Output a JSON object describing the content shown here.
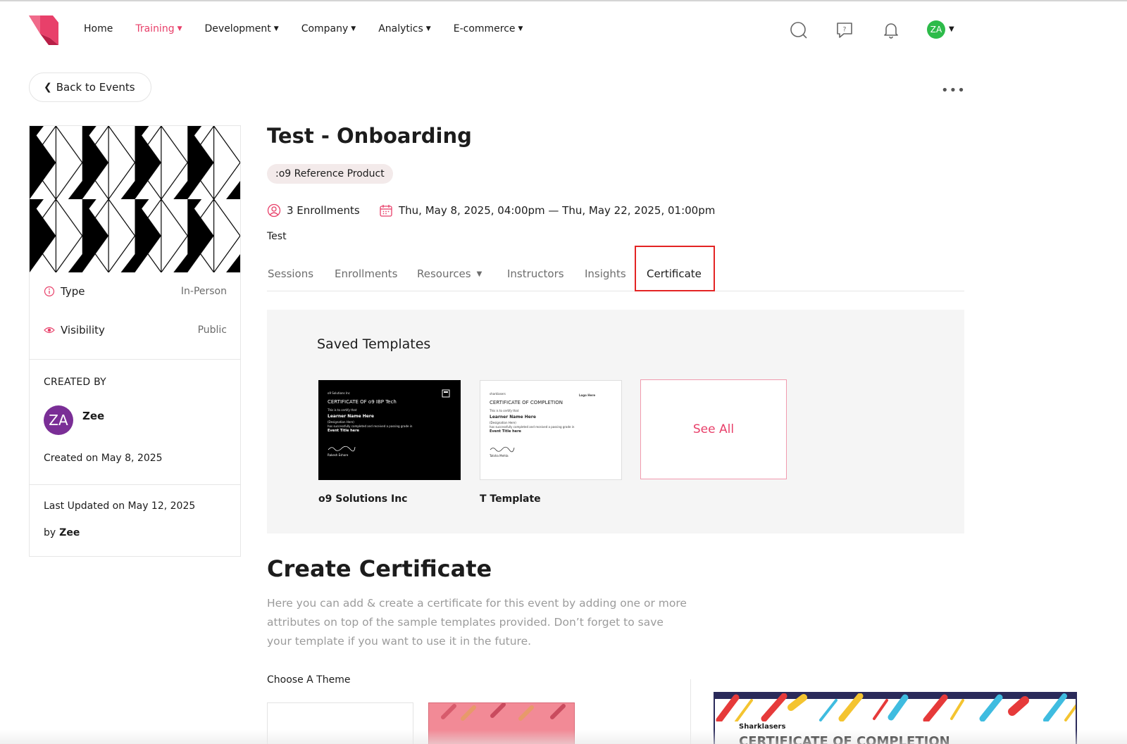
{
  "header": {
    "nav": [
      {
        "label": "Home",
        "active": false,
        "dropdown": false
      },
      {
        "label": "Training",
        "active": true,
        "dropdown": true
      },
      {
        "label": "Development",
        "active": false,
        "dropdown": true
      },
      {
        "label": "Company",
        "active": false,
        "dropdown": true
      },
      {
        "label": "Analytics",
        "active": false,
        "dropdown": true
      },
      {
        "label": "E-commerce",
        "active": false,
        "dropdown": true
      }
    ],
    "icons": [
      "search-icon",
      "help-chat-icon",
      "bell-icon"
    ],
    "user_initials": "ZA",
    "accent_color": "#e8406a"
  },
  "back_button": {
    "label": "Back to Events"
  },
  "event": {
    "title": "Test - Onboarding",
    "tag": ":o9 Reference Product",
    "enrollments": "3 Enrollments",
    "dates": "Thu, May 8, 2025, 04:00pm — Thu, May 22, 2025, 01:00pm",
    "description": "Test"
  },
  "sidebar": {
    "type_label": "Type",
    "type_value": "In-Person",
    "visibility_label": "Visibility",
    "visibility_value": "Public",
    "created_by_label": "CREATED BY",
    "creator_initials": "ZA",
    "creator_name": "Zee",
    "created_on": "Created on May 8, 2025",
    "last_updated": "Last Updated on May 12, 2025",
    "updated_by_prefix": "by",
    "updated_by_name": "Zee"
  },
  "tabs": [
    {
      "label": "Sessions",
      "active": false
    },
    {
      "label": "Enrollments",
      "active": false
    },
    {
      "label": "Resources",
      "active": false,
      "dropdown": true
    },
    {
      "label": "Instructors",
      "active": false
    },
    {
      "label": "Insights",
      "active": false
    },
    {
      "label": "Certificate",
      "active": true
    }
  ],
  "saved_templates": {
    "title": "Saved Templates",
    "items": [
      {
        "name": "o9 Solutions Inc",
        "theme": "dark",
        "org": "o9 Solutions Inc",
        "heading": "CERTIFICATE OF o9 IBP Tech",
        "certify": "This is to certify that",
        "learner": "Learner Name Here",
        "designation": "(Designation Here)",
        "body": "has successfully completed and received a passing grade in",
        "event": "Event Title here",
        "signer": "Rakesh Eshore"
      },
      {
        "name": "T Template",
        "theme": "light",
        "org": "sharklasers",
        "heading": "CERTIFICATE OF COMPLETION",
        "certify": "This is to certify that",
        "learner": "Learner Name Here",
        "designation": "(Designation Here)",
        "body": "has successfully completed and received a passing grade in",
        "event": "Event Title here",
        "signer": "Tatsha Mehta",
        "logo": "Logo Here"
      }
    ],
    "see_all": "See All"
  },
  "create": {
    "title": "Create Certificate",
    "description": "Here you can add & create a certificate for this event by adding one or more attributes on top of the sample templates provided. Don’t forget to save your template if you want to use it in the future.",
    "choose_theme": "Choose A Theme",
    "preview_brand": "Sharklasers",
    "preview_title": "CERTIFICATE OF COMPLETION"
  }
}
